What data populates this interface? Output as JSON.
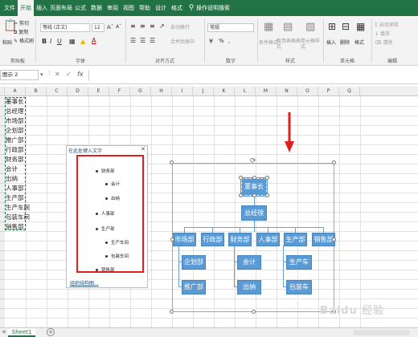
{
  "menu": {
    "file": "文件",
    "home": "开始",
    "insert": "插入",
    "page_layout": "页面布局",
    "formulas": "公式",
    "data": "数据",
    "review": "审阅",
    "view": "视图",
    "help": "帮助",
    "design": "设计",
    "format": "格式",
    "search": "操作说明搜索"
  },
  "ribbon": {
    "paste": "粘贴",
    "cut": "剪切",
    "copy": "复制",
    "format_painter": "格式刷",
    "font_name": "等线 (正文)",
    "font_size": "12",
    "wrap_text": "自动换行",
    "merge_center": "合并后居中",
    "number_format": "常规",
    "conditional_format": "条件格式",
    "format_as_table": "套用表格格式",
    "cell_styles": "单元格样式",
    "insert": "插入",
    "delete": "删除",
    "format": "格式",
    "autosum": "自动求和",
    "fill": "填充",
    "clear": "清除",
    "groups": {
      "clipboard": "剪贴板",
      "font": "字体",
      "alignment": "对齐方式",
      "number": "数字",
      "styles": "样式",
      "cells": "单元格",
      "editing": "编辑"
    }
  },
  "formula_bar": {
    "name_box": "图示 2",
    "fx": "fx"
  },
  "columns": [
    "A",
    "B",
    "C",
    "D",
    "E",
    "F",
    "G",
    "H",
    "I",
    "J",
    "K",
    "L",
    "M",
    "N",
    "O",
    "P",
    "Q"
  ],
  "column_a_values": [
    "董事长",
    "总经理",
    "市场部",
    "企划部",
    "推广部",
    "行政部",
    "财务部",
    "会计",
    "出纳",
    "人事部",
    "生产部",
    "生产车间",
    "包装车间",
    "销售部"
  ],
  "text_pane": {
    "title": "在此处键入文字",
    "items": [
      "财务部",
      "会计",
      "出纳",
      "人事部",
      "生产部",
      "生产车间",
      "包装车间",
      "销售部"
    ],
    "footer": "组织结构图..."
  },
  "org_chart": {
    "chairman": "董事长",
    "general_manager": "总经理",
    "departments": [
      "市场部",
      "行政部",
      "财务部",
      "人事部",
      "生产部",
      "销售部"
    ],
    "market_children": [
      "企划部",
      "推广部"
    ],
    "finance_children": [
      "会计",
      "出纳"
    ],
    "production_children": [
      "生产车间",
      "包装车间"
    ]
  },
  "sheet_tabs": {
    "active": "Sheet1",
    "add": "+"
  },
  "watermark": "Baidu 经验"
}
